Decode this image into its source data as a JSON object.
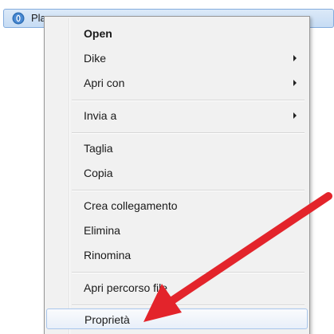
{
  "file": {
    "name": "Pla",
    "icon": "opera-icon"
  },
  "menu": {
    "items": [
      {
        "label": "Open",
        "bold": true,
        "submenu": false
      },
      {
        "label": "Dike",
        "bold": false,
        "submenu": true
      },
      {
        "label": "Apri con",
        "bold": false,
        "submenu": true
      },
      {
        "label": "Invia a",
        "bold": false,
        "submenu": true
      },
      {
        "label": "Taglia",
        "bold": false,
        "submenu": false
      },
      {
        "label": "Copia",
        "bold": false,
        "submenu": false
      },
      {
        "label": "Crea collegamento",
        "bold": false,
        "submenu": false
      },
      {
        "label": "Elimina",
        "bold": false,
        "submenu": false
      },
      {
        "label": "Rinomina",
        "bold": false,
        "submenu": false
      },
      {
        "label": "Apri percorso file",
        "bold": false,
        "submenu": false
      },
      {
        "label": "Proprietà",
        "bold": false,
        "submenu": false
      }
    ]
  },
  "annotation": {
    "icon": "red-arrow-icon",
    "color": "#e3242b"
  },
  "colors": {
    "menu_bg": "#f1f1f1",
    "selection_bg": "#c6dcf4",
    "hover_border": "#a8c6ec"
  }
}
